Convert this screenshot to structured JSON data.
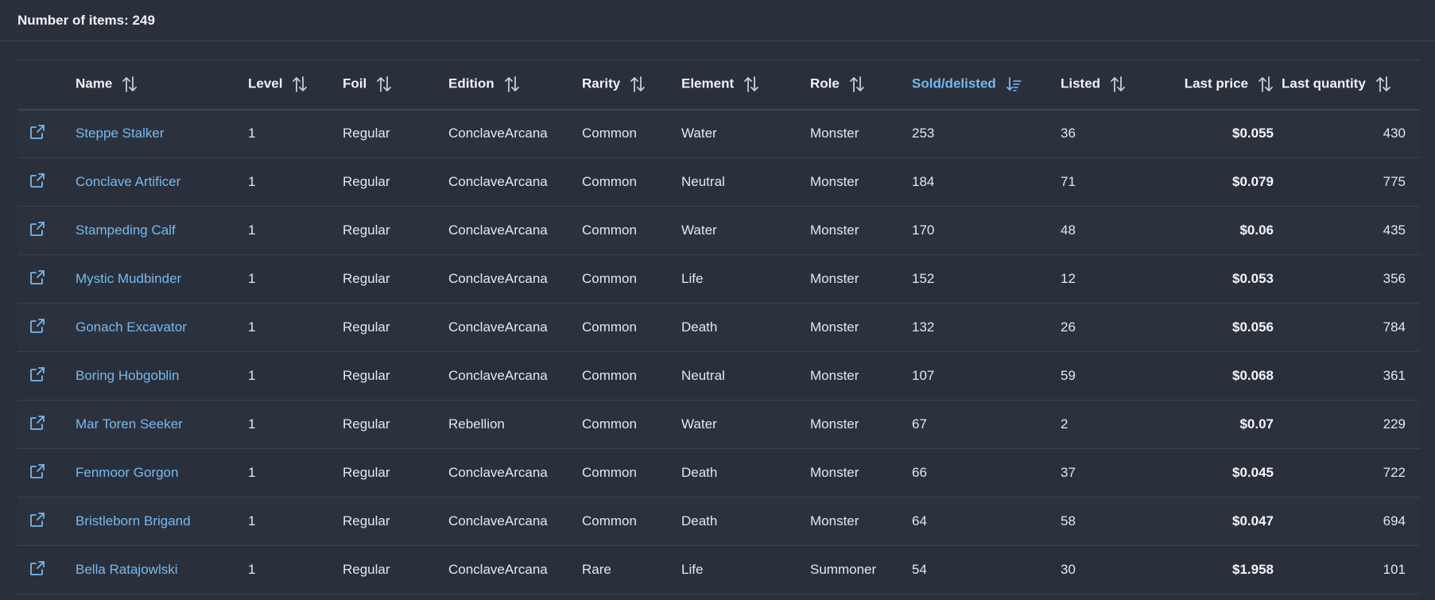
{
  "summary": {
    "label": "Number of items:",
    "count": "249"
  },
  "columns": [
    {
      "key": "name",
      "label": "Name",
      "sort": "none"
    },
    {
      "key": "level",
      "label": "Level",
      "sort": "none"
    },
    {
      "key": "foil",
      "label": "Foil",
      "sort": "none"
    },
    {
      "key": "edition",
      "label": "Edition",
      "sort": "none"
    },
    {
      "key": "rarity",
      "label": "Rarity",
      "sort": "none"
    },
    {
      "key": "element",
      "label": "Element",
      "sort": "none"
    },
    {
      "key": "role",
      "label": "Role",
      "sort": "none"
    },
    {
      "key": "sold_delisted",
      "label": "Sold/delisted",
      "sort": "desc"
    },
    {
      "key": "listed",
      "label": "Listed",
      "sort": "none"
    },
    {
      "key": "last_price",
      "label": "Last price",
      "sort": "none"
    },
    {
      "key": "last_quantity",
      "label": "Last quantity",
      "sort": "none"
    }
  ],
  "colors": {
    "background": "#2a303b",
    "link": "#77b8ef",
    "text": "#e4e7eb"
  },
  "rows": [
    {
      "name": "Steppe Stalker",
      "level": "1",
      "foil": "Regular",
      "edition": "ConclaveArcana",
      "rarity": "Common",
      "element": "Water",
      "role": "Monster",
      "sold_delisted": "253",
      "listed": "36",
      "last_price": "$0.055",
      "last_quantity": "430"
    },
    {
      "name": "Conclave Artificer",
      "level": "1",
      "foil": "Regular",
      "edition": "ConclaveArcana",
      "rarity": "Common",
      "element": "Neutral",
      "role": "Monster",
      "sold_delisted": "184",
      "listed": "71",
      "last_price": "$0.079",
      "last_quantity": "775"
    },
    {
      "name": "Stampeding Calf",
      "level": "1",
      "foil": "Regular",
      "edition": "ConclaveArcana",
      "rarity": "Common",
      "element": "Water",
      "role": "Monster",
      "sold_delisted": "170",
      "listed": "48",
      "last_price": "$0.06",
      "last_quantity": "435"
    },
    {
      "name": "Mystic Mudbinder",
      "level": "1",
      "foil": "Regular",
      "edition": "ConclaveArcana",
      "rarity": "Common",
      "element": "Life",
      "role": "Monster",
      "sold_delisted": "152",
      "listed": "12",
      "last_price": "$0.053",
      "last_quantity": "356"
    },
    {
      "name": "Gonach Excavator",
      "level": "1",
      "foil": "Regular",
      "edition": "ConclaveArcana",
      "rarity": "Common",
      "element": "Death",
      "role": "Monster",
      "sold_delisted": "132",
      "listed": "26",
      "last_price": "$0.056",
      "last_quantity": "784"
    },
    {
      "name": "Boring Hobgoblin",
      "level": "1",
      "foil": "Regular",
      "edition": "ConclaveArcana",
      "rarity": "Common",
      "element": "Neutral",
      "role": "Monster",
      "sold_delisted": "107",
      "listed": "59",
      "last_price": "$0.068",
      "last_quantity": "361"
    },
    {
      "name": "Mar Toren Seeker",
      "level": "1",
      "foil": "Regular",
      "edition": "Rebellion",
      "rarity": "Common",
      "element": "Water",
      "role": "Monster",
      "sold_delisted": "67",
      "listed": "2",
      "last_price": "$0.07",
      "last_quantity": "229"
    },
    {
      "name": "Fenmoor Gorgon",
      "level": "1",
      "foil": "Regular",
      "edition": "ConclaveArcana",
      "rarity": "Common",
      "element": "Death",
      "role": "Monster",
      "sold_delisted": "66",
      "listed": "37",
      "last_price": "$0.045",
      "last_quantity": "722"
    },
    {
      "name": "Bristleborn Brigand",
      "level": "1",
      "foil": "Regular",
      "edition": "ConclaveArcana",
      "rarity": "Common",
      "element": "Death",
      "role": "Monster",
      "sold_delisted": "64",
      "listed": "58",
      "last_price": "$0.047",
      "last_quantity": "694"
    },
    {
      "name": "Bella Ratajowlski",
      "level": "1",
      "foil": "Regular",
      "edition": "ConclaveArcana",
      "rarity": "Rare",
      "element": "Life",
      "role": "Summoner",
      "sold_delisted": "54",
      "listed": "30",
      "last_price": "$1.958",
      "last_quantity": "101"
    }
  ]
}
